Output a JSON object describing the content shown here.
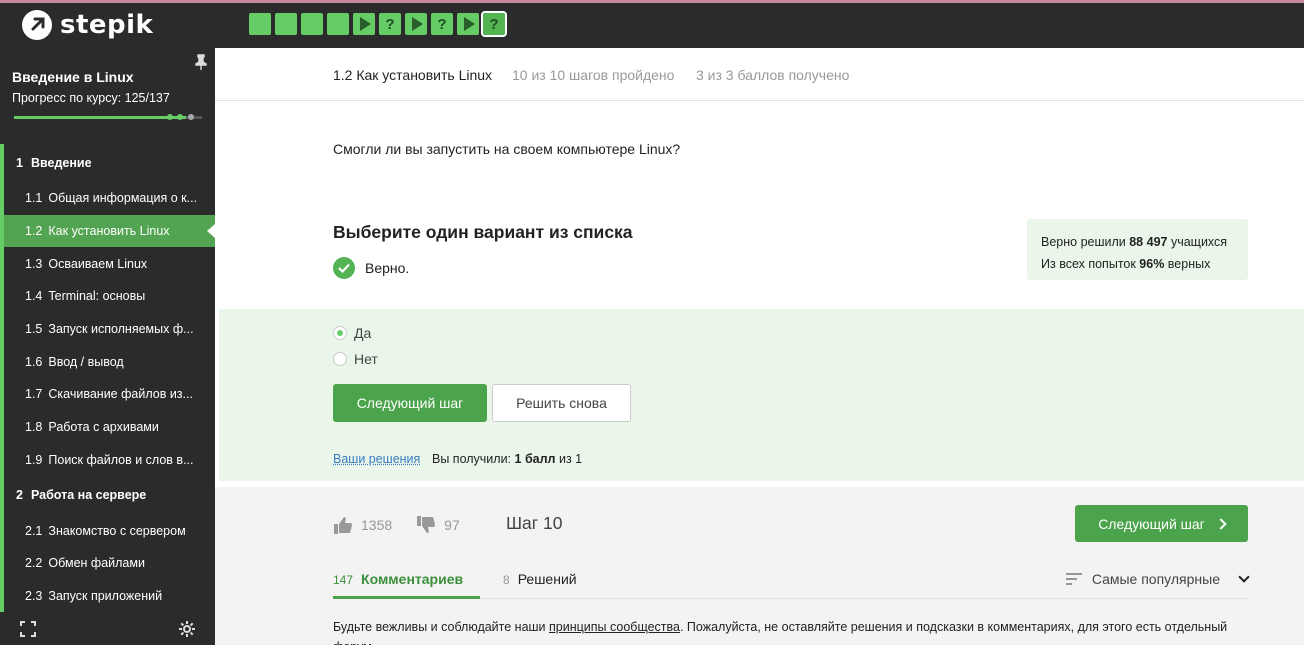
{
  "brand": {
    "name": "stepik"
  },
  "step_tiles": [
    {
      "type": "done"
    },
    {
      "type": "done"
    },
    {
      "type": "done"
    },
    {
      "type": "done"
    },
    {
      "type": "video"
    },
    {
      "type": "quiz",
      "glyph": "?"
    },
    {
      "type": "video"
    },
    {
      "type": "quiz",
      "glyph": "?"
    },
    {
      "type": "video"
    },
    {
      "type": "quiz",
      "glyph": "?",
      "active": true
    }
  ],
  "sidebar": {
    "course_title": "Введение в Linux",
    "progress_label": "Прогресс по курсу:  125/137",
    "progress": {
      "value": 125,
      "max": 137
    },
    "sections": [
      {
        "num": "1",
        "title": "Введение",
        "lessons": [
          {
            "num": "1.1",
            "title": "Общая информация о к..."
          },
          {
            "num": "1.2",
            "title": "Как установить Linux",
            "active": true
          },
          {
            "num": "1.3",
            "title": "Осваиваем Linux"
          },
          {
            "num": "1.4",
            "title": "Terminal: основы"
          },
          {
            "num": "1.5",
            "title": "Запуск исполняемых ф..."
          },
          {
            "num": "1.6",
            "title": "Ввод / вывод"
          },
          {
            "num": "1.7",
            "title": "Скачивание файлов из..."
          },
          {
            "num": "1.8",
            "title": "Работа с архивами"
          },
          {
            "num": "1.9",
            "title": "Поиск файлов и слов в..."
          }
        ]
      },
      {
        "num": "2",
        "title": "Работа на сервере",
        "lessons": [
          {
            "num": "2.1",
            "title": "Знакомство с сервером"
          },
          {
            "num": "2.2",
            "title": "Обмен файлами"
          },
          {
            "num": "2.3",
            "title": "Запуск приложений"
          }
        ]
      }
    ]
  },
  "lesson": {
    "title": "1.2 Как установить Linux",
    "steps_status": "10 из 10 шагов пройдено",
    "score_status": "3 из 3 баллов  получено"
  },
  "quiz": {
    "question": "Смогли ли вы запустить на своем компьютере Linux?",
    "heading": "Выберите один вариант из списка",
    "verdict": "Верно.",
    "stats_line1_prefix": "Верно решили ",
    "stats_line1_value": "88 497",
    "stats_line1_suffix": " учащихся",
    "stats_line2_prefix": "Из всех попыток ",
    "stats_line2_value": "96%",
    "stats_line2_suffix": " верных",
    "options": [
      {
        "label": "Да",
        "selected": true
      },
      {
        "label": "Нет",
        "selected": false
      }
    ],
    "next_button": "Следующий шаг",
    "retry_button": "Решить снова",
    "your_solutions": "Ваши решения",
    "score_prefix": "Вы получили: ",
    "score_value": "1 балл",
    "score_suffix": " из 1"
  },
  "footer": {
    "likes": "1358",
    "dislikes": "97",
    "step_label": "Шаг 10",
    "next_button": "Следующий шаг",
    "tabs": [
      {
        "count": "147",
        "label": "Комментариев",
        "active": true
      },
      {
        "count": "8",
        "label": "Решений",
        "active": false
      }
    ],
    "sort_label": "Самые популярные",
    "rules_prefix": "Будьте вежливы и соблюдайте наши ",
    "rules_link": "принципы сообщества",
    "rules_suffix": ". Пожалуйста, не оставляйте решения и подсказки в комментариях, для этого есть отдельный форум."
  },
  "colors": {
    "accent": "#4ba34b",
    "sidebar_bg": "#2b2b2b",
    "success_bg": "#e9f6e9"
  }
}
